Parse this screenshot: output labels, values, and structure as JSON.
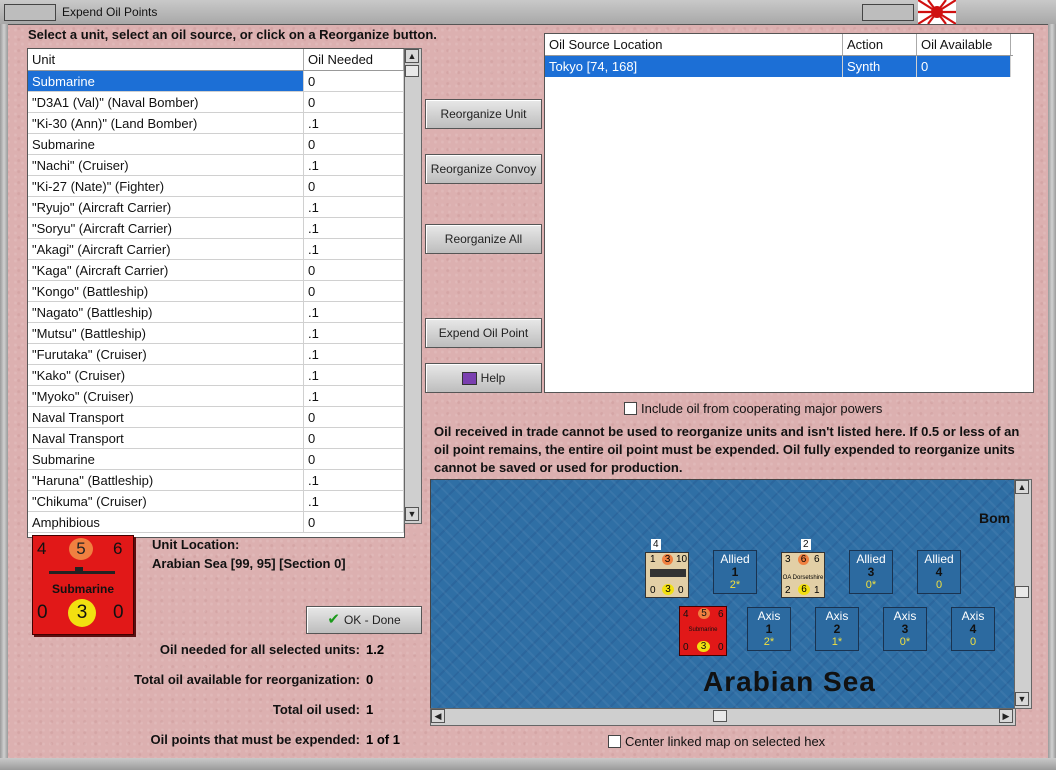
{
  "window": {
    "title": "Expend Oil Points"
  },
  "instruction": "Select a unit, select an oil source, or click on a Reorganize button.",
  "unit_table": {
    "headers": [
      "Unit",
      "Oil Needed"
    ],
    "rows": [
      [
        "Submarine",
        "0"
      ],
      [
        "\"D3A1 (Val)\" (Naval Bomber)",
        "0"
      ],
      [
        "\"Ki-30 (Ann)\" (Land Bomber)",
        ".1"
      ],
      [
        "Submarine",
        "0"
      ],
      [
        "\"Nachi\" (Cruiser)",
        ".1"
      ],
      [
        "\"Ki-27 (Nate)\" (Fighter)",
        "0"
      ],
      [
        "\"Ryujo\" (Aircraft Carrier)",
        ".1"
      ],
      [
        "\"Soryu\" (Aircraft Carrier)",
        ".1"
      ],
      [
        "\"Akagi\" (Aircraft Carrier)",
        ".1"
      ],
      [
        "\"Kaga\" (Aircraft Carrier)",
        "0"
      ],
      [
        "\"Kongo\" (Battleship)",
        "0"
      ],
      [
        "\"Nagato\" (Battleship)",
        ".1"
      ],
      [
        "\"Mutsu\" (Battleship)",
        ".1"
      ],
      [
        "\"Furutaka\" (Cruiser)",
        ".1"
      ],
      [
        "\"Kako\" (Cruiser)",
        ".1"
      ],
      [
        "\"Myoko\" (Cruiser)",
        ".1"
      ],
      [
        "Naval Transport",
        "0"
      ],
      [
        "Naval Transport",
        "0"
      ],
      [
        "Submarine",
        "0"
      ],
      [
        "\"Haruna\" (Battleship)",
        ".1"
      ],
      [
        "\"Chikuma\" (Cruiser)",
        ".1"
      ],
      [
        "Amphibious",
        "0"
      ]
    ],
    "selected_index": 0
  },
  "buttons": {
    "reorganize_unit": "Reorganize Unit",
    "reorganize_convoy": "Reorganize Convoy",
    "reorganize_all": "Reorganize All",
    "expend_oil_point": "Expend Oil Point",
    "help": "Help",
    "ok_done": "OK - Done"
  },
  "oil_table": {
    "headers": [
      "Oil Source Location",
      "Action",
      "Oil Available"
    ],
    "rows": [
      [
        "Tokyo [74, 168]",
        "Synth",
        "0"
      ]
    ]
  },
  "include_cooperating": {
    "label": "Include oil from cooperating major powers",
    "checked": false
  },
  "note": "Oil received in trade cannot be used to reorganize units and isn't listed here.  If 0.5 or less of an oil point remains, the entire oil point must be expended.   Oil fully expended to reorganize units cannot be saved or used for production.",
  "unit_info": {
    "location_label": "Unit Location:",
    "location_value": "Arabian Sea [99, 95] [Section 0]",
    "counter": {
      "top_left": "4",
      "top_mid": "5",
      "top_right": "6",
      "name": "Submarine",
      "bot_left": "0",
      "bot_mid": "3",
      "bot_right": "0"
    }
  },
  "totals": [
    {
      "label": "Oil needed for all selected units:",
      "value": "1.2"
    },
    {
      "label": "Total oil available for reorganization:",
      "value": "0"
    },
    {
      "label": "Total oil used:",
      "value": "1"
    },
    {
      "label": "Oil points that must be expended:",
      "value": "1 of 1"
    }
  ],
  "map": {
    "sea_name": "Arabian Sea",
    "partial_text": "Bom",
    "allied_slots": [
      {
        "label": "Allied",
        "num": "1",
        "val": "2*"
      },
      {
        "label": "Allied",
        "num": "3",
        "val": "0*"
      },
      {
        "label": "Allied",
        "num": "4",
        "val": "0"
      }
    ],
    "axis_slots": [
      {
        "label": "Axis",
        "num": "1",
        "val": "2*"
      },
      {
        "label": "Axis",
        "num": "2",
        "val": "1*"
      },
      {
        "label": "Axis",
        "num": "3",
        "val": "0*"
      },
      {
        "label": "Axis",
        "num": "4",
        "val": "0"
      }
    ],
    "ship1": {
      "stack": "4",
      "a": "1",
      "b": "3",
      "c": "10",
      "d": "0",
      "e": "3",
      "f": "0"
    },
    "ship2": {
      "stack": "2",
      "a": "3",
      "b": "6",
      "c": "6",
      "name": "OA Dorsetshire",
      "d": "2",
      "e": "6",
      "f": "1"
    },
    "sub_counter": {
      "a": "4",
      "b": "5",
      "c": "6",
      "name": "Submarine",
      "d": "0",
      "e": "3",
      "f": "0"
    }
  },
  "center_map": {
    "label": "Center linked map on selected hex",
    "checked": false
  },
  "colors": {
    "selection": "#1c6fd6",
    "background": "#dcb0b0",
    "sea": "#2f6fa5",
    "counter_red": "#e11818"
  }
}
